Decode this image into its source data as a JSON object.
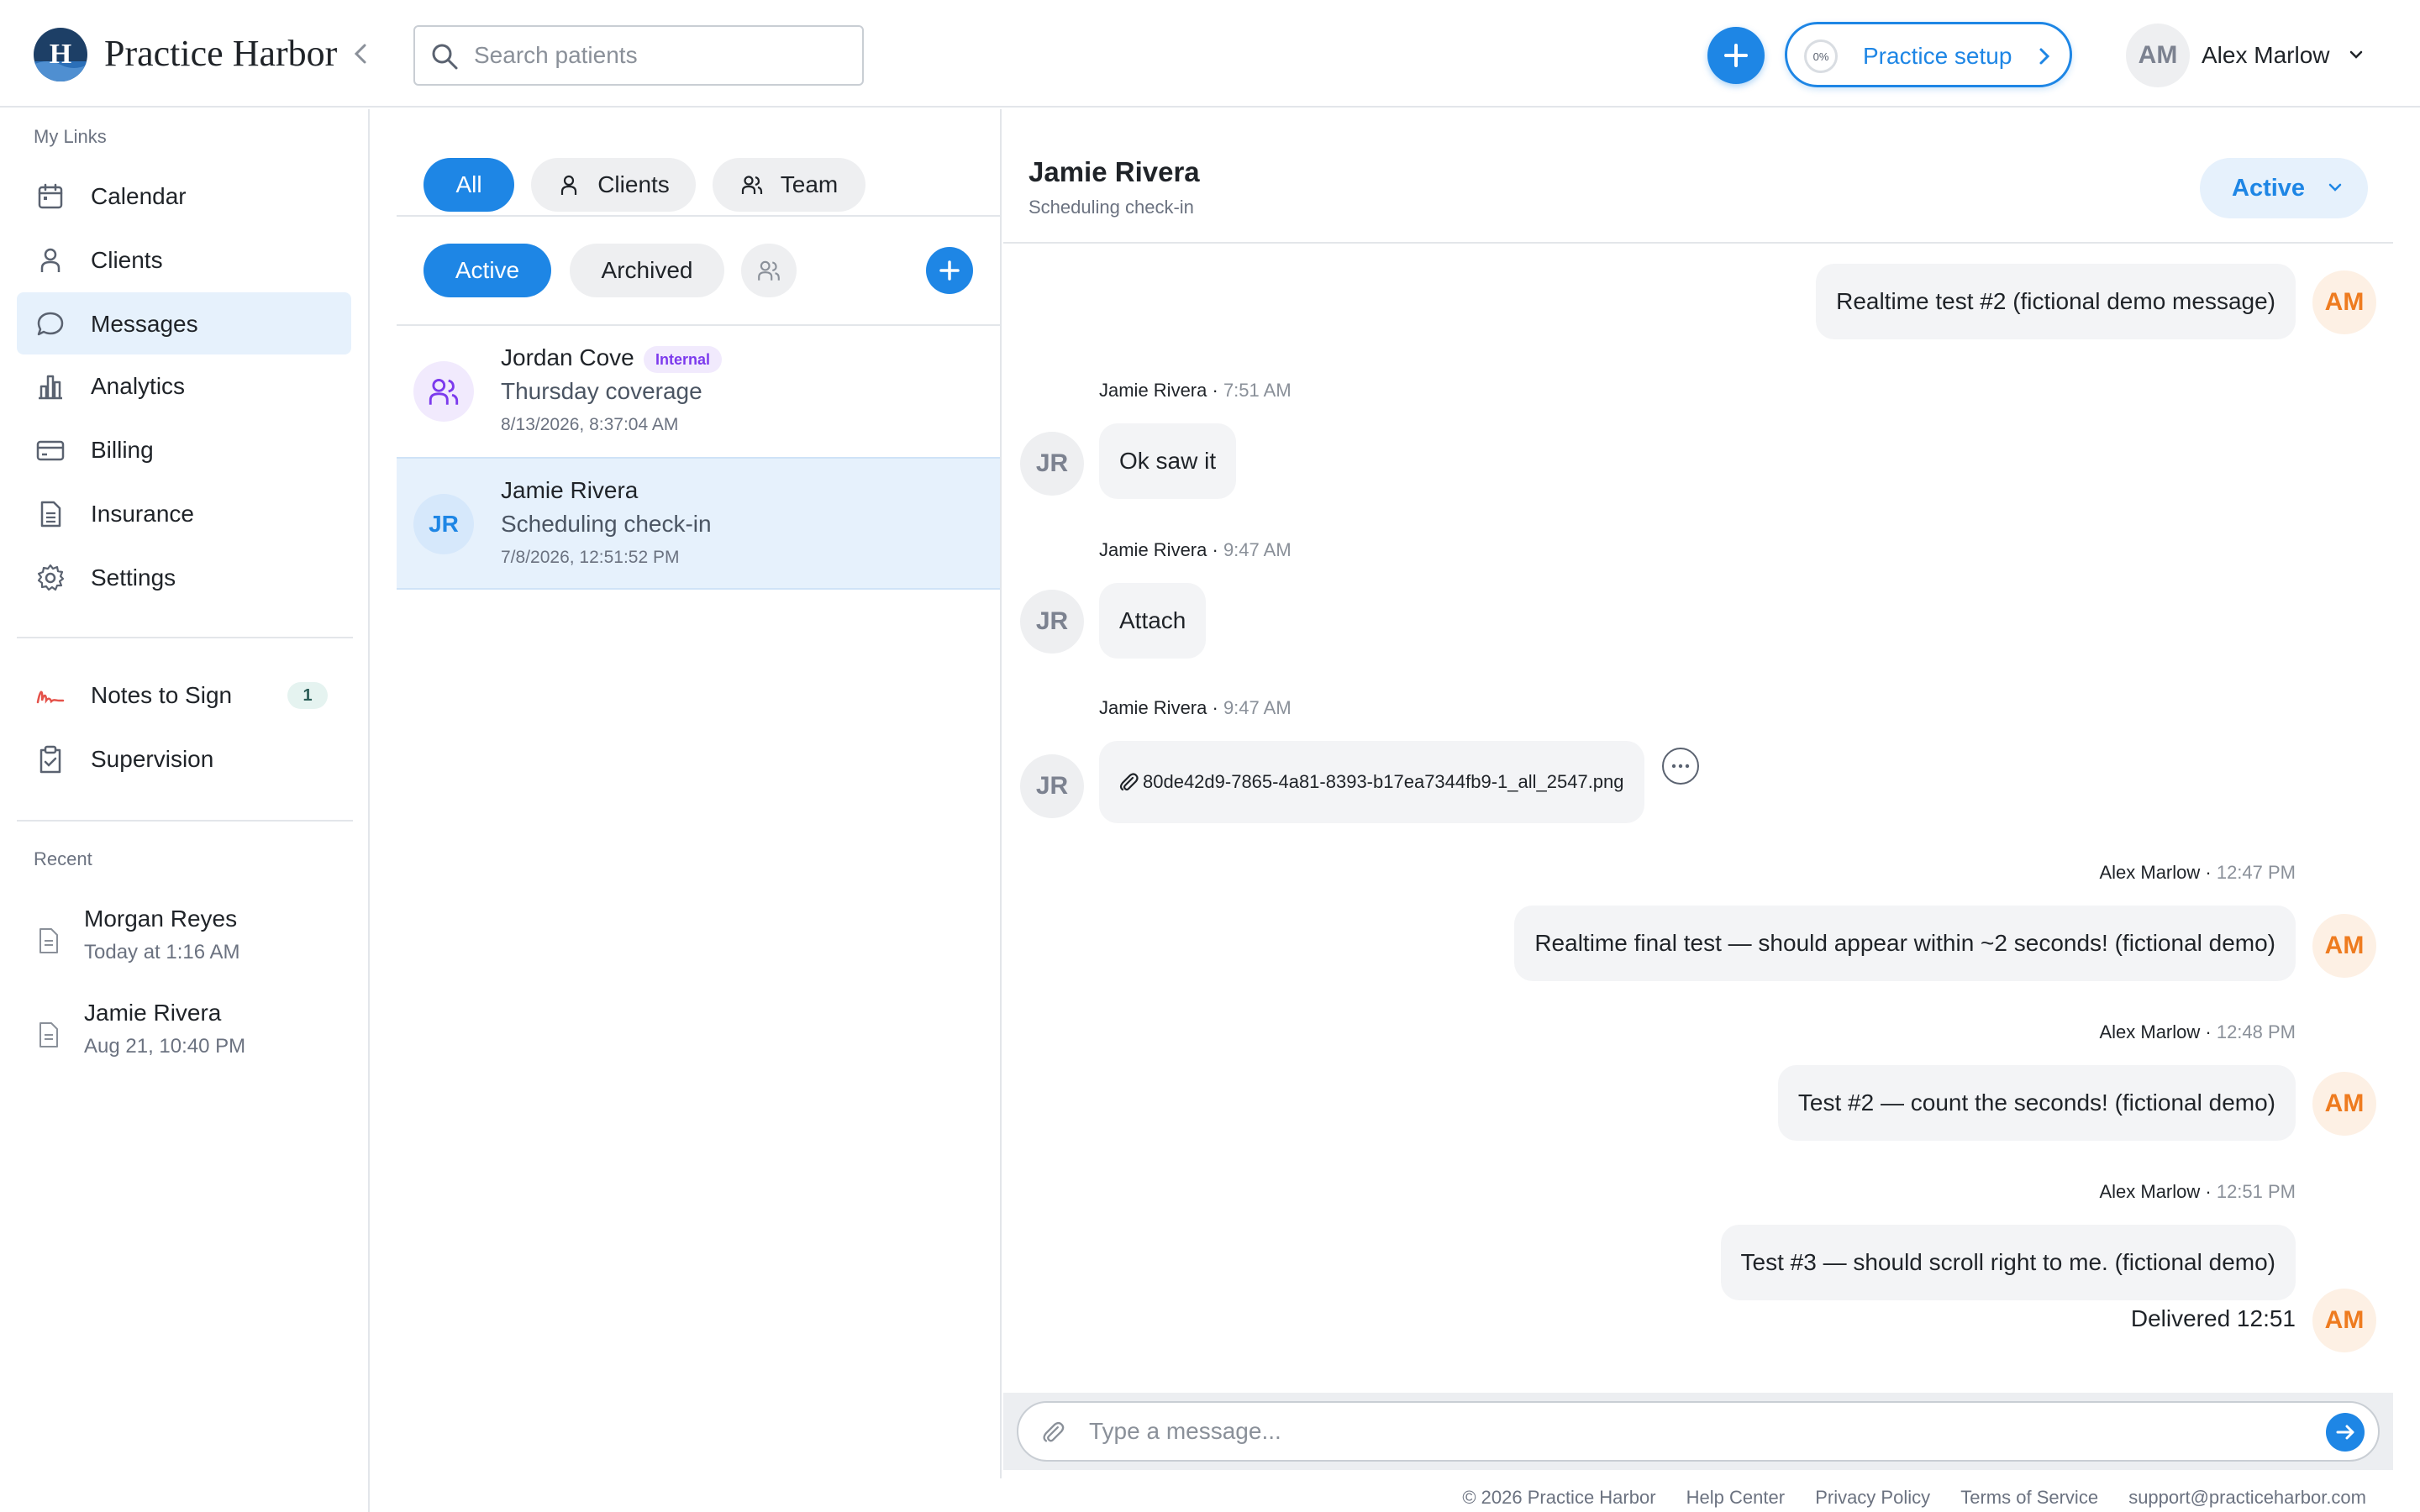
{
  "header": {
    "app_title": "Practice Harbor",
    "search_placeholder": "Search patients",
    "setup_progress": "0%",
    "setup_label": "Practice setup",
    "user_initials": "AM",
    "user_name": "Alex Marlow"
  },
  "sidebar": {
    "section_links": "My Links",
    "items": [
      {
        "label": "Calendar",
        "icon": "calendar-icon"
      },
      {
        "label": "Clients",
        "icon": "person-icon"
      },
      {
        "label": "Messages",
        "icon": "chat-icon",
        "active": true
      },
      {
        "label": "Analytics",
        "icon": "bar-chart-icon"
      },
      {
        "label": "Billing",
        "icon": "credit-card-icon"
      },
      {
        "label": "Insurance",
        "icon": "document-icon"
      },
      {
        "label": "Settings",
        "icon": "gear-icon"
      }
    ],
    "notes_to_sign": {
      "label": "Notes to Sign",
      "count": "1"
    },
    "supervision": {
      "label": "Supervision"
    },
    "section_recent": "Recent",
    "recent": [
      {
        "name": "Morgan Reyes",
        "time": "Today at 1:16 AM"
      },
      {
        "name": "Jamie Rivera",
        "time": "Aug 21, 10:40 PM"
      }
    ]
  },
  "conversations": {
    "filters": {
      "all": "All",
      "clients": "Clients",
      "team": "Team"
    },
    "status_filters": {
      "active": "Active",
      "archived": "Archived"
    },
    "items": [
      {
        "name": "Jordan Cove",
        "tag": "Internal",
        "subject": "Thursday coverage",
        "date": "8/13/2026, 8:37:04 AM"
      },
      {
        "initials": "JR",
        "name": "Jamie Rivera",
        "subject": "Scheduling check-in",
        "date": "7/8/2026, 12:51:52 PM",
        "selected": true
      }
    ]
  },
  "chat": {
    "title": "Jamie Rivera",
    "subtitle": "Scheduling check-in",
    "status": "Active",
    "messages": [
      {
        "text": "Realtime test #2 (fictional demo message)",
        "initials": "AM"
      },
      {
        "sender": "Jamie Rivera",
        "time": "7:51 AM",
        "text": "Ok saw it",
        "initials": "JR"
      },
      {
        "sender": "Jamie Rivera",
        "time": "9:47 AM",
        "text": "Attach",
        "initials": "JR"
      },
      {
        "sender": "Jamie Rivera",
        "time": "9:47 AM",
        "text": "80de42d9-7865-4a81-8393-b17ea7344fb9-1_all_2547.png",
        "initials": "JR"
      },
      {
        "sender": "Alex Marlow",
        "time": "12:47 PM",
        "text": "Realtime final test — should appear within ~2 seconds! (fictional demo)",
        "initials": "AM"
      },
      {
        "sender": "Alex Marlow",
        "time": "12:48 PM",
        "text": "Test #2 — count the seconds! (fictional demo)",
        "initials": "AM"
      },
      {
        "sender": "Alex Marlow",
        "time": "12:51 PM",
        "text": "Test #3 — should scroll right to me. (fictional demo)",
        "initials": "AM"
      }
    ],
    "delivered": "Delivered 12:51",
    "composer_placeholder": "Type a message..."
  },
  "footer": {
    "copyright": "© 2026 Practice Harbor",
    "help": "Help Center",
    "privacy": "Privacy Policy",
    "terms": "Terms of Service",
    "email": "support@practiceharbor.com"
  },
  "colors": {
    "accent": "#1e86e5",
    "am_avatar": "#ee7b1f",
    "internal_tag": "#7c3aed"
  }
}
